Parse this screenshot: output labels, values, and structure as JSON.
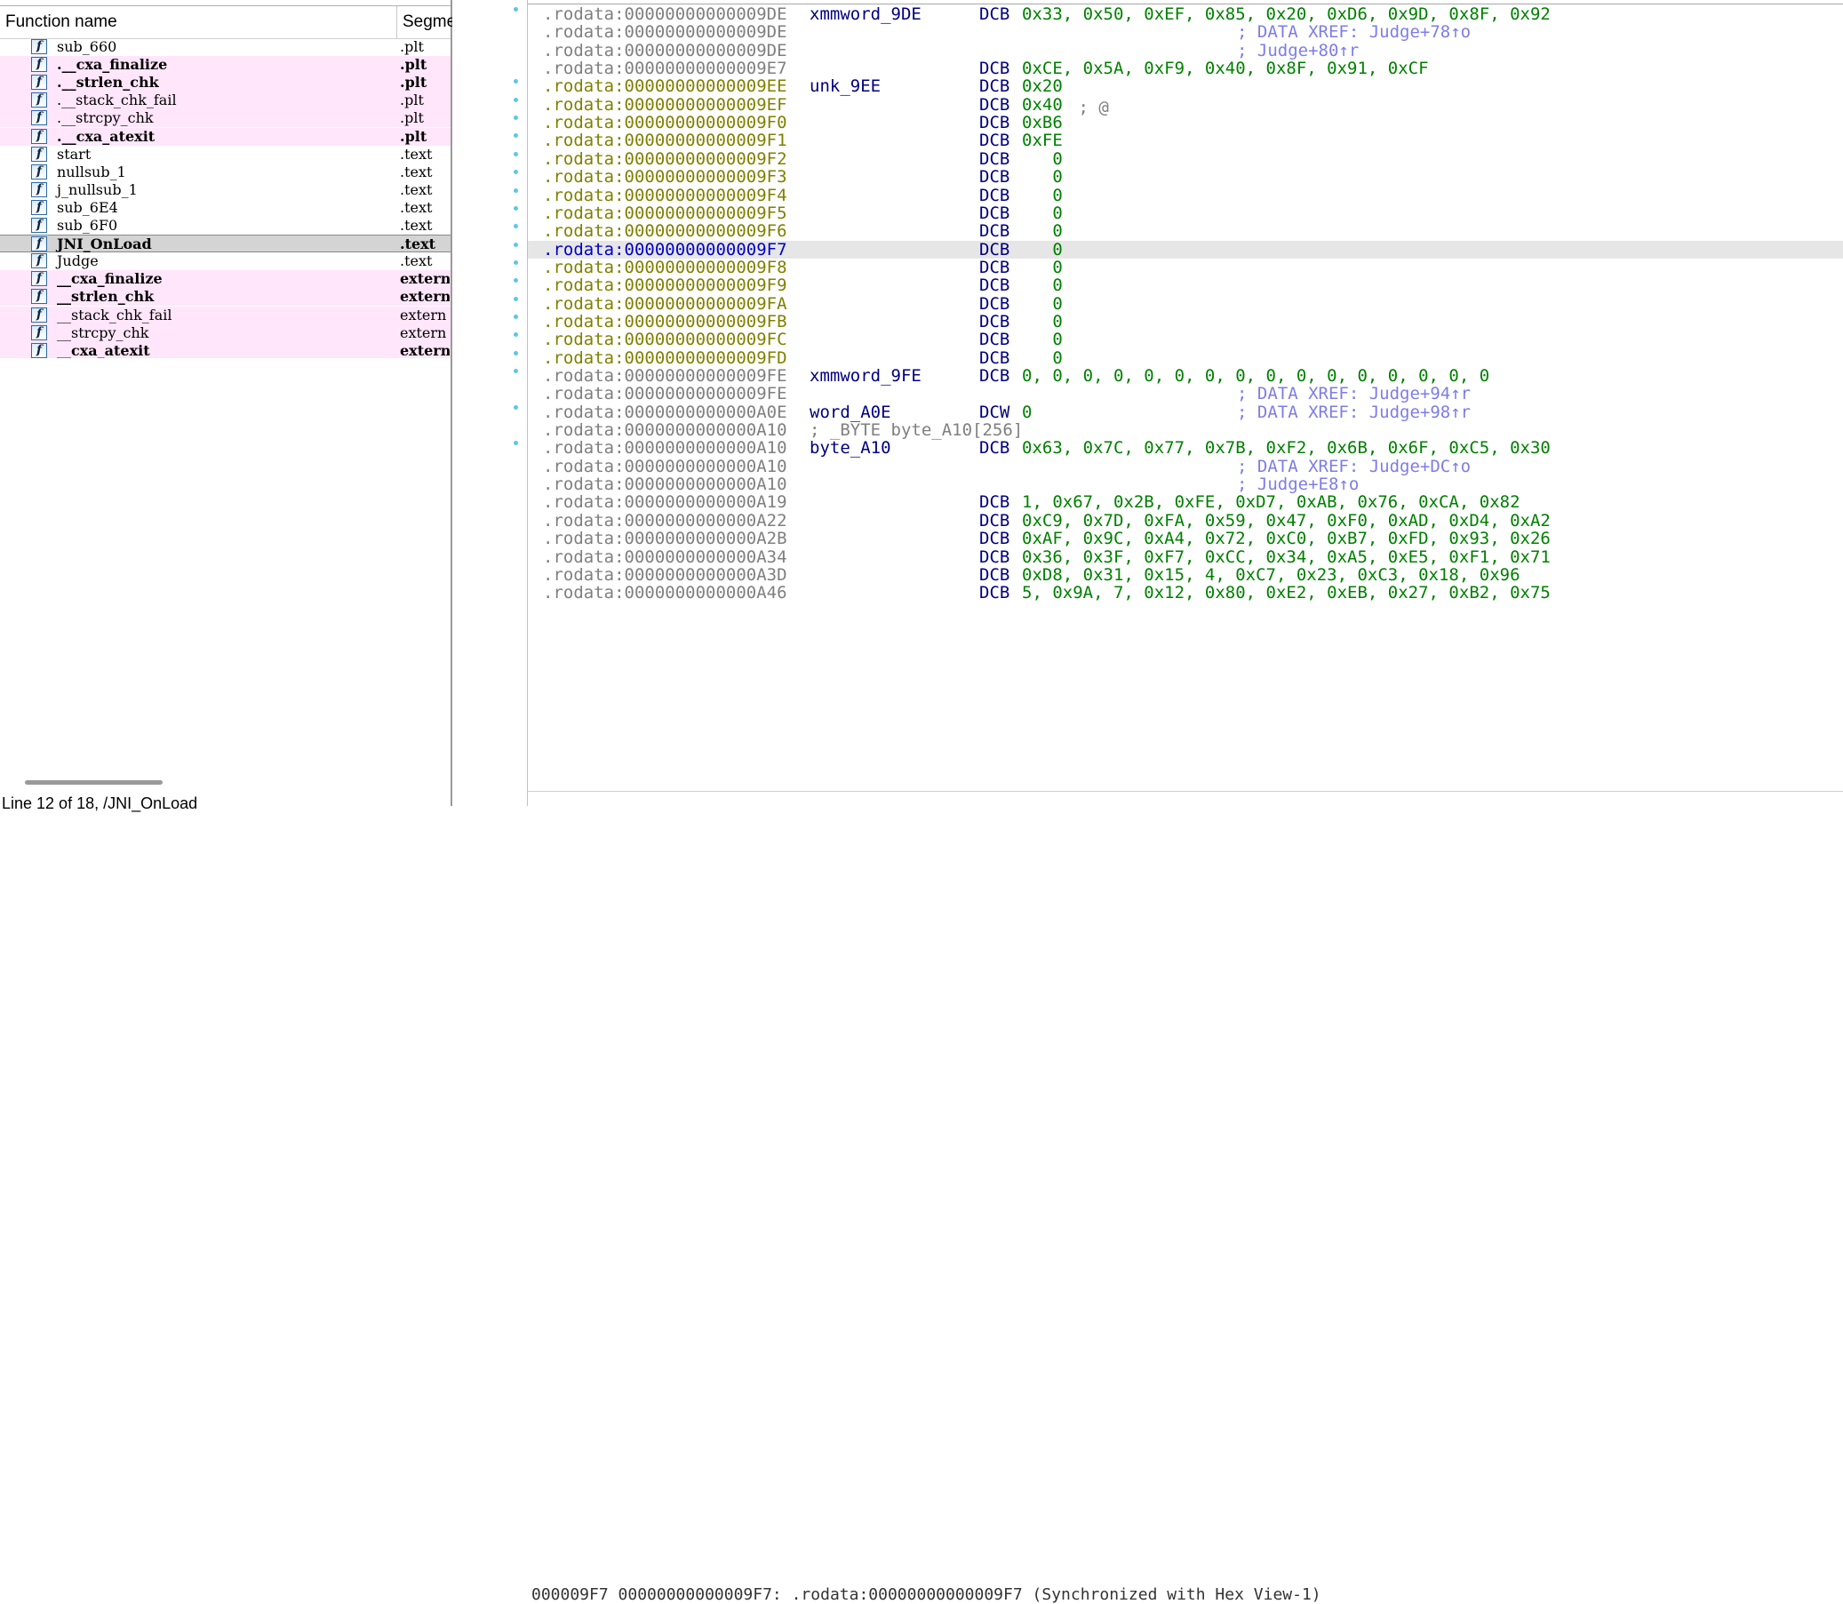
{
  "functions_window": {
    "header": {
      "name": "Function name",
      "segment": "Segme"
    },
    "rows": [
      {
        "name": "sub_660",
        "segment": ".plt",
        "bold": false,
        "pink": false
      },
      {
        "name": ".__cxa_finalize",
        "segment": ".plt",
        "bold": true,
        "pink": true
      },
      {
        "name": ".__strlen_chk",
        "segment": ".plt",
        "bold": true,
        "pink": true
      },
      {
        "name": ".__stack_chk_fail",
        "segment": ".plt",
        "bold": false,
        "pink": true
      },
      {
        "name": ".__strcpy_chk",
        "segment": ".plt",
        "bold": false,
        "pink": true
      },
      {
        "name": ".__cxa_atexit",
        "segment": ".plt",
        "bold": true,
        "pink": true
      },
      {
        "name": "start",
        "segment": ".text",
        "bold": false,
        "pink": false
      },
      {
        "name": "nullsub_1",
        "segment": ".text",
        "bold": false,
        "pink": false
      },
      {
        "name": "j_nullsub_1",
        "segment": ".text",
        "bold": false,
        "pink": false
      },
      {
        "name": "sub_6E4",
        "segment": ".text",
        "bold": false,
        "pink": false
      },
      {
        "name": "sub_6F0",
        "segment": ".text",
        "bold": false,
        "pink": false
      },
      {
        "name": "JNI_OnLoad",
        "segment": ".text",
        "bold": true,
        "pink": false,
        "selected": true
      },
      {
        "name": "Judge",
        "segment": ".text",
        "bold": false,
        "pink": false
      },
      {
        "name": "__cxa_finalize",
        "segment": "extern",
        "bold": true,
        "pink": true
      },
      {
        "name": "__strlen_chk",
        "segment": "extern",
        "bold": true,
        "pink": true
      },
      {
        "name": "__stack_chk_fail",
        "segment": "extern",
        "bold": false,
        "pink": true
      },
      {
        "name": "__strcpy_chk",
        "segment": "extern",
        "bold": false,
        "pink": true
      },
      {
        "name": "__cxa_atexit",
        "segment": "extern",
        "bold": true,
        "pink": true
      }
    ],
    "status": "Line 12 of 18, /JNI_OnLoad"
  },
  "disassembly": {
    "rows": [
      {
        "seg": ".rodata:00000000000009DE",
        "color": "gray",
        "dot": true,
        "label": "xmmword_9DE",
        "op": "DCB",
        "val": "0x33, 0x50, 0xEF, 0x85, 0x20, 0xD6, 0x9D, 0x8F, 0x92",
        "xref": ""
      },
      {
        "seg": ".rodata:00000000000009DE",
        "color": "gray",
        "dot": false,
        "label": "",
        "op": "",
        "val": "",
        "xref": "; DATA XREF: Judge+78↑o"
      },
      {
        "seg": ".rodata:00000000000009DE",
        "color": "gray",
        "dot": false,
        "label": "",
        "op": "",
        "val": "",
        "xref": "; Judge+80↑r"
      },
      {
        "seg": ".rodata:00000000000009E7",
        "color": "gray",
        "dot": false,
        "label": "",
        "op": "DCB",
        "val": "0xCE, 0x5A, 0xF9, 0x40, 0x8F, 0x91, 0xCF",
        "xref": ""
      },
      {
        "seg": ".rodata:00000000000009EE",
        "color": "olive",
        "dot": true,
        "label": "unk_9EE",
        "op": "DCB",
        "val": "0x20",
        "xref": ""
      },
      {
        "seg": ".rodata:00000000000009EF",
        "color": "olive",
        "dot": true,
        "label": "",
        "op": "DCB",
        "val": "0x40",
        "comment": " ; @",
        "xref": ""
      },
      {
        "seg": ".rodata:00000000000009F0",
        "color": "olive",
        "dot": true,
        "label": "",
        "op": "DCB",
        "val": "0xB6",
        "xref": ""
      },
      {
        "seg": ".rodata:00000000000009F1",
        "color": "olive",
        "dot": true,
        "label": "",
        "op": "DCB",
        "val": "0xFE",
        "xref": ""
      },
      {
        "seg": ".rodata:00000000000009F2",
        "color": "olive",
        "dot": true,
        "label": "",
        "op": "DCB",
        "val": "   0",
        "xref": ""
      },
      {
        "seg": ".rodata:00000000000009F3",
        "color": "olive",
        "dot": true,
        "label": "",
        "op": "DCB",
        "val": "   0",
        "xref": ""
      },
      {
        "seg": ".rodata:00000000000009F4",
        "color": "olive",
        "dot": true,
        "label": "",
        "op": "DCB",
        "val": "   0",
        "xref": ""
      },
      {
        "seg": ".rodata:00000000000009F5",
        "color": "olive",
        "dot": true,
        "label": "",
        "op": "DCB",
        "val": "   0",
        "xref": ""
      },
      {
        "seg": ".rodata:00000000000009F6",
        "color": "olive",
        "dot": true,
        "label": "",
        "op": "DCB",
        "val": "   0",
        "xref": ""
      },
      {
        "seg": ".rodata:00000000000009F7",
        "color": "blue",
        "dot": true,
        "label": "",
        "op": "DCB",
        "val": "   0",
        "xref": "",
        "current": true
      },
      {
        "seg": ".rodata:00000000000009F8",
        "color": "olive",
        "dot": true,
        "label": "",
        "op": "DCB",
        "val": "   0",
        "xref": ""
      },
      {
        "seg": ".rodata:00000000000009F9",
        "color": "olive",
        "dot": true,
        "label": "",
        "op": "DCB",
        "val": "   0",
        "xref": ""
      },
      {
        "seg": ".rodata:00000000000009FA",
        "color": "olive",
        "dot": true,
        "label": "",
        "op": "DCB",
        "val": "   0",
        "xref": ""
      },
      {
        "seg": ".rodata:00000000000009FB",
        "color": "olive",
        "dot": true,
        "label": "",
        "op": "DCB",
        "val": "   0",
        "xref": ""
      },
      {
        "seg": ".rodata:00000000000009FC",
        "color": "olive",
        "dot": true,
        "label": "",
        "op": "DCB",
        "val": "   0",
        "xref": ""
      },
      {
        "seg": ".rodata:00000000000009FD",
        "color": "olive",
        "dot": true,
        "label": "",
        "op": "DCB",
        "val": "   0",
        "xref": ""
      },
      {
        "seg": ".rodata:00000000000009FE",
        "color": "gray",
        "dot": true,
        "label": "xmmword_9FE",
        "op": "DCB",
        "val": "0, 0, 0, 0, 0, 0, 0, 0, 0, 0, 0, 0, 0, 0, 0, 0",
        "xref": ""
      },
      {
        "seg": ".rodata:00000000000009FE",
        "color": "gray",
        "dot": false,
        "label": "",
        "op": "",
        "val": "",
        "xref": "; DATA XREF: Judge+94↑r"
      },
      {
        "seg": ".rodata:0000000000000A0E",
        "color": "gray",
        "dot": true,
        "label": "word_A0E",
        "op": "DCW",
        "val": "0",
        "xref": "; DATA XREF: Judge+98↑r"
      },
      {
        "seg": ".rodata:0000000000000A10",
        "color": "gray",
        "dot": false,
        "label": "",
        "op": "",
        "val": "",
        "comment_full": "; _BYTE byte_A10[256]",
        "xref": ""
      },
      {
        "seg": ".rodata:0000000000000A10",
        "color": "gray",
        "dot": true,
        "label": "byte_A10",
        "op": "DCB",
        "val": "0x63, 0x7C, 0x77, 0x7B, 0xF2, 0x6B, 0x6F, 0xC5, 0x30",
        "xref": ""
      },
      {
        "seg": ".rodata:0000000000000A10",
        "color": "gray",
        "dot": false,
        "label": "",
        "op": "",
        "val": "",
        "xref": "; DATA XREF: Judge+DC↑o"
      },
      {
        "seg": ".rodata:0000000000000A10",
        "color": "gray",
        "dot": false,
        "label": "",
        "op": "",
        "val": "",
        "xref": "; Judge+E8↑o"
      },
      {
        "seg": ".rodata:0000000000000A19",
        "color": "gray",
        "dot": false,
        "label": "",
        "op": "DCB",
        "val": "1, 0x67, 0x2B, 0xFE, 0xD7, 0xAB, 0x76, 0xCA, 0x82",
        "xref": ""
      },
      {
        "seg": ".rodata:0000000000000A22",
        "color": "gray",
        "dot": false,
        "label": "",
        "op": "DCB",
        "val": "0xC9, 0x7D, 0xFA, 0x59, 0x47, 0xF0, 0xAD, 0xD4, 0xA2",
        "xref": ""
      },
      {
        "seg": ".rodata:0000000000000A2B",
        "color": "gray",
        "dot": false,
        "label": "",
        "op": "DCB",
        "val": "0xAF, 0x9C, 0xA4, 0x72, 0xC0, 0xB7, 0xFD, 0x93, 0x26",
        "xref": ""
      },
      {
        "seg": ".rodata:0000000000000A34",
        "color": "gray",
        "dot": false,
        "label": "",
        "op": "DCB",
        "val": "0x36, 0x3F, 0xF7, 0xCC, 0x34, 0xA5, 0xE5, 0xF1, 0x71",
        "xref": ""
      },
      {
        "seg": ".rodata:0000000000000A3D",
        "color": "gray",
        "dot": false,
        "label": "",
        "op": "DCB",
        "val": "0xD8, 0x31, 0x15, 4, 0xC7, 0x23, 0xC3, 0x18, 0x96",
        "xref": ""
      },
      {
        "seg": ".rodata:0000000000000A46",
        "color": "gray",
        "dot": false,
        "label": "",
        "op": "DCB",
        "val": "5, 0x9A, 7, 0x12, 0x80, 0xE2, 0xEB, 0x27, 0xB2, 0x75",
        "xref": ""
      }
    ],
    "status": "000009F7 00000000000009F7: .rodata:00000000000009F7 (Synchronized with Hex View-1)"
  },
  "colors": {
    "pink_row": "#ffe6fa",
    "selected_row": "#d4d4d4",
    "current_line": "#e6e6e6",
    "address_olive": "#808000",
    "address_gray": "#7f7f7f",
    "operand_green": "#008000",
    "mnemonic_navy": "#000080",
    "xref_violet": "#7d7de6"
  }
}
